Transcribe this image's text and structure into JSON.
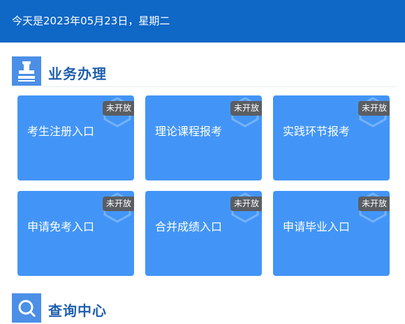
{
  "header": {
    "date_text": "今天是2023年05月23日，星期二"
  },
  "sections": [
    {
      "title": "业务办理",
      "icon": "stamp-icon",
      "cards": [
        {
          "label": "考生注册入口",
          "badge": "未开放"
        },
        {
          "label": "理论课程报考",
          "badge": "未开放"
        },
        {
          "label": "实践环节报考",
          "badge": "未开放"
        },
        {
          "label": "申请免考入口",
          "badge": "未开放"
        },
        {
          "label": "合并成绩入口",
          "badge": "未开放"
        },
        {
          "label": "申请毕业入口",
          "badge": "未开放"
        }
      ]
    },
    {
      "title": "查询中心",
      "icon": "search-icon"
    }
  ],
  "colors": {
    "header_bg": "#0f67c6",
    "card_bg": "#4295f7",
    "badge_bg": "#5a5e63",
    "section_title": "#1f5fad",
    "icon_box": "#4b8fe6"
  }
}
